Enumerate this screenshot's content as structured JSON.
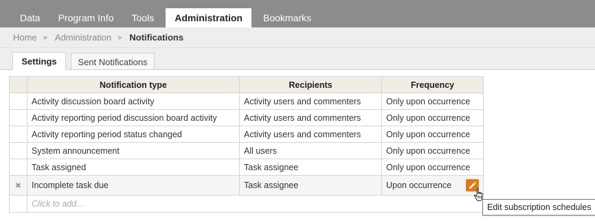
{
  "topnav": {
    "tabs": [
      {
        "label": "Data"
      },
      {
        "label": "Program Info"
      },
      {
        "label": "Tools"
      },
      {
        "label": "Administration",
        "active": true
      },
      {
        "label": "Bookmarks"
      }
    ]
  },
  "breadcrumb": {
    "home": "Home",
    "section": "Administration",
    "current": "Notifications"
  },
  "subtabs": {
    "settings": "Settings",
    "sent": "Sent Notifications"
  },
  "grid": {
    "headers": {
      "type": "Notification type",
      "recipients": "Recipients",
      "frequency": "Frequency"
    },
    "rows": [
      {
        "type": "Activity discussion board activity",
        "recipients": "Activity users and commenters",
        "frequency": "Only upon occurrence"
      },
      {
        "type": "Activity reporting period discussion board activity",
        "recipients": "Activity users and commenters",
        "frequency": "Only upon occurrence"
      },
      {
        "type": "Activity reporting period status changed",
        "recipients": "Activity users and commenters",
        "frequency": "Only upon occurrence"
      },
      {
        "type": "System announcement",
        "recipients": "All users",
        "frequency": "Only upon occurrence"
      },
      {
        "type": "Task assigned",
        "recipients": "Task assignee",
        "frequency": "Only upon occurrence"
      },
      {
        "type": "Incomplete task due",
        "recipients": "Task assignee",
        "frequency": "Upon occurrence"
      }
    ],
    "add_placeholder": "Click to add...",
    "delete_glyph": "✖"
  },
  "tooltip": {
    "text": "Edit subscription schedules"
  },
  "colors": {
    "nav_bg": "#8c8c8c",
    "header_bg": "#f1ede4",
    "edit_button": "#e07b1a"
  }
}
